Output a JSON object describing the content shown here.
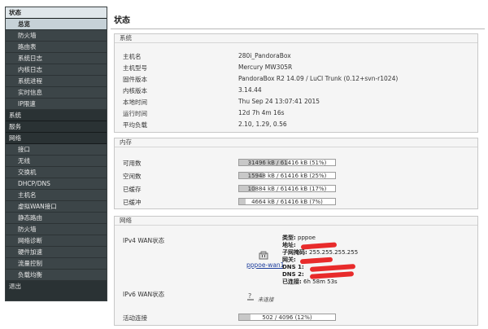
{
  "sidebar": {
    "items": [
      {
        "label": "状态"
      },
      {
        "label": "总览"
      },
      {
        "label": "防火墙"
      },
      {
        "label": "路由表"
      },
      {
        "label": "系统日志"
      },
      {
        "label": "内核日志"
      },
      {
        "label": "系统进程"
      },
      {
        "label": "实时信息"
      },
      {
        "label": "IP限速"
      },
      {
        "label": "系统"
      },
      {
        "label": "服务"
      },
      {
        "label": "网络"
      },
      {
        "label": "接口"
      },
      {
        "label": "无线"
      },
      {
        "label": "交换机"
      },
      {
        "label": "DHCP/DNS"
      },
      {
        "label": "主机名"
      },
      {
        "label": "虚拟WAN接口"
      },
      {
        "label": "静态路由"
      },
      {
        "label": "防火墙"
      },
      {
        "label": "网络诊断"
      },
      {
        "label": "硬件加速"
      },
      {
        "label": "流量控制"
      },
      {
        "label": "负载均衡"
      },
      {
        "label": "退出"
      }
    ]
  },
  "page": {
    "title": "状态"
  },
  "system": {
    "legend": "系统",
    "rows": [
      {
        "label": "主机名",
        "value": "280i_PandoraBox"
      },
      {
        "label": "主机型号",
        "value": "Mercury MW305R"
      },
      {
        "label": "固件版本",
        "value": "PandoraBox R2 14.09 / LuCI Trunk (0.12+svn-r1024)"
      },
      {
        "label": "内核版本",
        "value": "3.14.44"
      },
      {
        "label": "本地时间",
        "value": "Thu Sep 24 13:07:41 2015"
      },
      {
        "label": "运行时间",
        "value": "12d 7h 4m 16s"
      },
      {
        "label": "平均负载",
        "value": "2.10, 1.29, 0.56"
      }
    ]
  },
  "memory": {
    "legend": "内存",
    "rows": [
      {
        "label": "可用数",
        "text": "31496 kB / 61416 kB (51%)",
        "fraction": 0.51
      },
      {
        "label": "空闲数",
        "text": "15948 kB / 61416 kB (25%)",
        "fraction": 0.25
      },
      {
        "label": "已缓存",
        "text": "10884 kB / 61416 kB (17%)",
        "fraction": 0.17
      },
      {
        "label": "已缓冲",
        "text": "4664 kB / 61416 kB (7%)",
        "fraction": 0.07
      }
    ]
  },
  "network": {
    "legend": "网络",
    "ipv4_label": "IPv4 WAN状态",
    "ipv4_link": "pppoe-wan1",
    "details": {
      "type_label": "类型:",
      "type_value": "pppoe",
      "addr_label": "地址:",
      "mask_label": "子网掩码:",
      "mask_value": "255.255.255.255",
      "gw_label": "网关:",
      "dns1_label": "DNS 1:",
      "dns2_label": "DNS 2:",
      "conn_label": "已连接:",
      "conn_value": "6h 58m 53s"
    },
    "ipv6_label": "IPv6 WAN状态",
    "ipv6_status": "未连接",
    "active_label": "活动连接",
    "active_text": "502 / 4096 (12%)",
    "active_fraction": 0.12
  },
  "colors": {
    "redaction": "#e82b2b",
    "sidebar_bg": "#1f2527"
  },
  "icons": {
    "network_port": "network-port-icon",
    "unknown_device": "question-device-icon"
  }
}
